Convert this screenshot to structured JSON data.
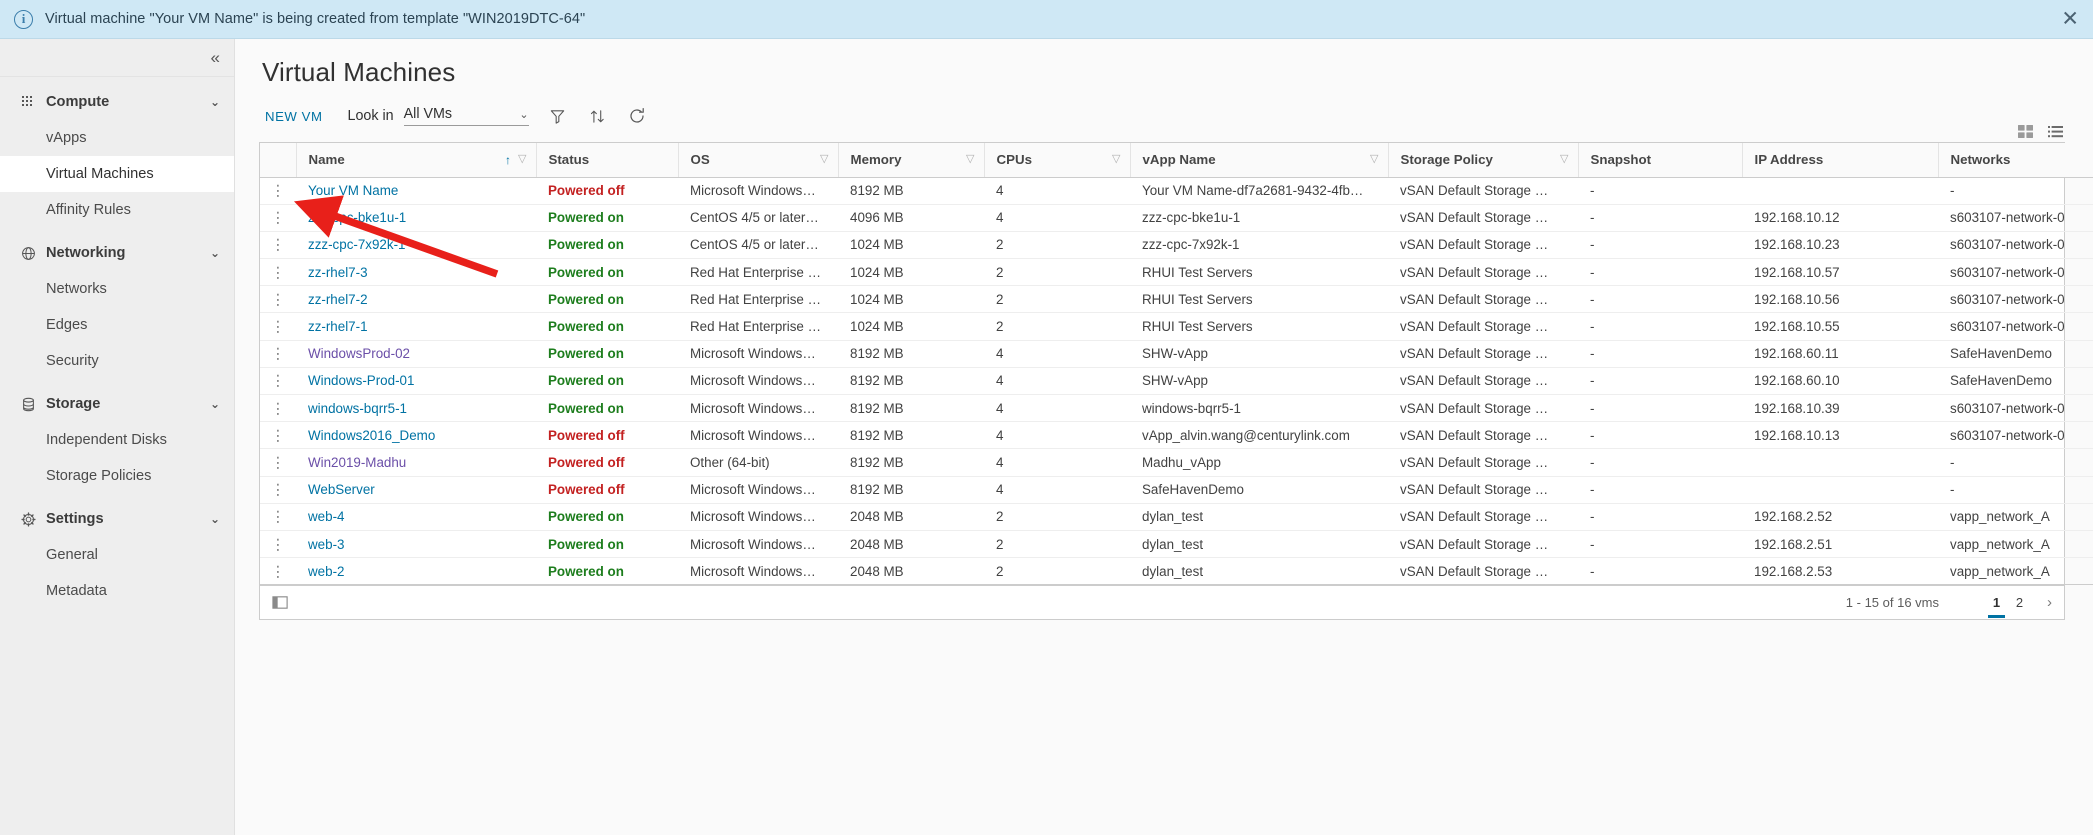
{
  "notification": {
    "icon": "info-circle-icon",
    "message": "Virtual machine \"Your VM Name\" is being created from template \"WIN2019DTC-64\"",
    "close_label": "✕"
  },
  "sidebar": {
    "collapse_label": "«",
    "groups": [
      {
        "label": "Compute",
        "icon": "grid-dots-icon",
        "caret": "⌄",
        "items": [
          {
            "label": "vApps",
            "active": false
          },
          {
            "label": "Virtual Machines",
            "active": true
          },
          {
            "label": "Affinity Rules",
            "active": false
          }
        ]
      },
      {
        "label": "Networking",
        "icon": "globe-icon",
        "caret": "⌄",
        "items": [
          {
            "label": "Networks",
            "active": false
          },
          {
            "label": "Edges",
            "active": false
          },
          {
            "label": "Security",
            "active": false
          }
        ]
      },
      {
        "label": "Storage",
        "icon": "database-icon",
        "caret": "⌄",
        "items": [
          {
            "label": "Independent Disks",
            "active": false
          },
          {
            "label": "Storage Policies",
            "active": false
          }
        ]
      },
      {
        "label": "Settings",
        "icon": "gear-icon",
        "caret": "⌄",
        "items": [
          {
            "label": "General",
            "active": false
          },
          {
            "label": "Metadata",
            "active": false
          }
        ]
      }
    ]
  },
  "header": {
    "title": "Virtual Machines"
  },
  "toolbar": {
    "new_vm_label": "NEW VM",
    "look_in_label": "Look in",
    "look_in_value": "All VMs",
    "look_in_caret": "⌄",
    "filter_icon": "filter-funnel-icon",
    "sort_icon": "sort-arrows-icon",
    "refresh_icon": "refresh-icon",
    "view_card_icon": "card-view-icon",
    "view_list_icon": "list-view-icon"
  },
  "table": {
    "columns": [
      {
        "key": "kebab",
        "label": "",
        "sorted": false,
        "filter": false
      },
      {
        "key": "name",
        "label": "Name",
        "sorted": true,
        "filter": true
      },
      {
        "key": "status",
        "label": "Status",
        "sorted": false,
        "filter": false
      },
      {
        "key": "os",
        "label": "OS",
        "sorted": false,
        "filter": true
      },
      {
        "key": "memory",
        "label": "Memory",
        "sorted": false,
        "filter": true
      },
      {
        "key": "cpus",
        "label": "CPUs",
        "sorted": false,
        "filter": true
      },
      {
        "key": "vapp",
        "label": "vApp Name",
        "sorted": false,
        "filter": true
      },
      {
        "key": "policy",
        "label": "Storage Policy",
        "sorted": false,
        "filter": true
      },
      {
        "key": "snap",
        "label": "Snapshot",
        "sorted": false,
        "filter": false
      },
      {
        "key": "ip",
        "label": "IP Address",
        "sorted": false,
        "filter": false
      },
      {
        "key": "net",
        "label": "Networks",
        "sorted": false,
        "filter": false
      }
    ],
    "rows": [
      {
        "kebab": "⋮",
        "name": "Your VM Name",
        "name_visited": false,
        "status": "Powered off",
        "status_state": "off",
        "os": "Microsoft Windows…",
        "memory": "8192 MB",
        "cpus": "4",
        "vapp": "Your VM Name-df7a2681-9432-4fb…",
        "policy": "vSAN Default Storage …",
        "snap": "-",
        "ip": "",
        "net": "-"
      },
      {
        "kebab": "⋮",
        "name": "zzz-cpc-bke1u-1",
        "name_visited": false,
        "status": "Powered on",
        "status_state": "on",
        "os": "CentOS 4/5 or later…",
        "memory": "4096 MB",
        "cpus": "4",
        "vapp": "zzz-cpc-bke1u-1",
        "policy": "vSAN Default Storage …",
        "snap": "-",
        "ip": "192.168.10.12",
        "net": "s603107-network-0"
      },
      {
        "kebab": "⋮",
        "name": "zzz-cpc-7x92k-1",
        "name_visited": false,
        "status": "Powered on",
        "status_state": "on",
        "os": "CentOS 4/5 or later…",
        "memory": "1024 MB",
        "cpus": "2",
        "vapp": "zzz-cpc-7x92k-1",
        "policy": "vSAN Default Storage …",
        "snap": "-",
        "ip": "192.168.10.23",
        "net": "s603107-network-0"
      },
      {
        "kebab": "⋮",
        "name": "zz-rhel7-3",
        "name_visited": false,
        "status": "Powered on",
        "status_state": "on",
        "os": "Red Hat Enterprise …",
        "memory": "1024 MB",
        "cpus": "2",
        "vapp": "RHUI Test Servers",
        "policy": "vSAN Default Storage …",
        "snap": "-",
        "ip": "192.168.10.57",
        "net": "s603107-network-0"
      },
      {
        "kebab": "⋮",
        "name": "zz-rhel7-2",
        "name_visited": false,
        "status": "Powered on",
        "status_state": "on",
        "os": "Red Hat Enterprise …",
        "memory": "1024 MB",
        "cpus": "2",
        "vapp": "RHUI Test Servers",
        "policy": "vSAN Default Storage …",
        "snap": "-",
        "ip": "192.168.10.56",
        "net": "s603107-network-0"
      },
      {
        "kebab": "⋮",
        "name": "zz-rhel7-1",
        "name_visited": false,
        "status": "Powered on",
        "status_state": "on",
        "os": "Red Hat Enterprise …",
        "memory": "1024 MB",
        "cpus": "2",
        "vapp": "RHUI Test Servers",
        "policy": "vSAN Default Storage …",
        "snap": "-",
        "ip": "192.168.10.55",
        "net": "s603107-network-0"
      },
      {
        "kebab": "⋮",
        "name": "WindowsProd-02",
        "name_visited": true,
        "status": "Powered on",
        "status_state": "on",
        "os": "Microsoft Windows…",
        "memory": "8192 MB",
        "cpus": "4",
        "vapp": "SHW-vApp",
        "policy": "vSAN Default Storage …",
        "snap": "-",
        "ip": "192.168.60.11",
        "net": "SafeHavenDemo"
      },
      {
        "kebab": "⋮",
        "name": "Windows-Prod-01",
        "name_visited": false,
        "status": "Powered on",
        "status_state": "on",
        "os": "Microsoft Windows…",
        "memory": "8192 MB",
        "cpus": "4",
        "vapp": "SHW-vApp",
        "policy": "vSAN Default Storage …",
        "snap": "-",
        "ip": "192.168.60.10",
        "net": "SafeHavenDemo"
      },
      {
        "kebab": "⋮",
        "name": "windows-bqrr5-1",
        "name_visited": false,
        "status": "Powered on",
        "status_state": "on",
        "os": "Microsoft Windows…",
        "memory": "8192 MB",
        "cpus": "4",
        "vapp": "windows-bqrr5-1",
        "policy": "vSAN Default Storage …",
        "snap": "-",
        "ip": "192.168.10.39",
        "net": "s603107-network-0"
      },
      {
        "kebab": "⋮",
        "name": "Windows2016_Demo",
        "name_visited": false,
        "status": "Powered off",
        "status_state": "off",
        "os": "Microsoft Windows…",
        "memory": "8192 MB",
        "cpus": "4",
        "vapp": "vApp_alvin.wang@centurylink.com",
        "policy": "vSAN Default Storage …",
        "snap": "-",
        "ip": "192.168.10.13",
        "net": "s603107-network-0"
      },
      {
        "kebab": "⋮",
        "name": "Win2019-Madhu",
        "name_visited": true,
        "status": "Powered off",
        "status_state": "off",
        "os": "Other (64-bit)",
        "memory": "8192 MB",
        "cpus": "4",
        "vapp": "Madhu_vApp",
        "policy": "vSAN Default Storage …",
        "snap": "-",
        "ip": "",
        "net": "-"
      },
      {
        "kebab": "⋮",
        "name": "WebServer",
        "name_visited": false,
        "status": "Powered off",
        "status_state": "off",
        "os": "Microsoft Windows…",
        "memory": "8192 MB",
        "cpus": "4",
        "vapp": "SafeHavenDemo",
        "policy": "vSAN Default Storage …",
        "snap": "-",
        "ip": "",
        "net": "-"
      },
      {
        "kebab": "⋮",
        "name": "web-4",
        "name_visited": false,
        "status": "Powered on",
        "status_state": "on",
        "os": "Microsoft Windows…",
        "memory": "2048 MB",
        "cpus": "2",
        "vapp": "dylan_test",
        "policy": "vSAN Default Storage …",
        "snap": "-",
        "ip": "192.168.2.52",
        "net": "vapp_network_A"
      },
      {
        "kebab": "⋮",
        "name": "web-3",
        "name_visited": false,
        "status": "Powered on",
        "status_state": "on",
        "os": "Microsoft Windows…",
        "memory": "2048 MB",
        "cpus": "2",
        "vapp": "dylan_test",
        "policy": "vSAN Default Storage …",
        "snap": "-",
        "ip": "192.168.2.51",
        "net": "vapp_network_A"
      },
      {
        "kebab": "⋮",
        "name": "web-2",
        "name_visited": false,
        "status": "Powered on",
        "status_state": "on",
        "os": "Microsoft Windows…",
        "memory": "2048 MB",
        "cpus": "2",
        "vapp": "dylan_test",
        "policy": "vSAN Default Storage …",
        "snap": "-",
        "ip": "192.168.2.53",
        "net": "vapp_network_A"
      }
    ]
  },
  "footer": {
    "columns_toggle_icon": "column-picker-icon",
    "count_text": "1 - 15 of 16 vms",
    "pages": [
      "1",
      "2"
    ],
    "current_page": "1",
    "next_label": "›"
  },
  "annotation": {
    "type": "red-arrow",
    "points_to": "Your VM Name"
  },
  "colors": {
    "accent": "#0072a3",
    "powered_on": "#1d7d1d",
    "powered_off": "#c32121",
    "notification_bg": "#cfe8f5",
    "sidebar_bg": "#eeeeee",
    "annotation_red": "#e8201a"
  }
}
